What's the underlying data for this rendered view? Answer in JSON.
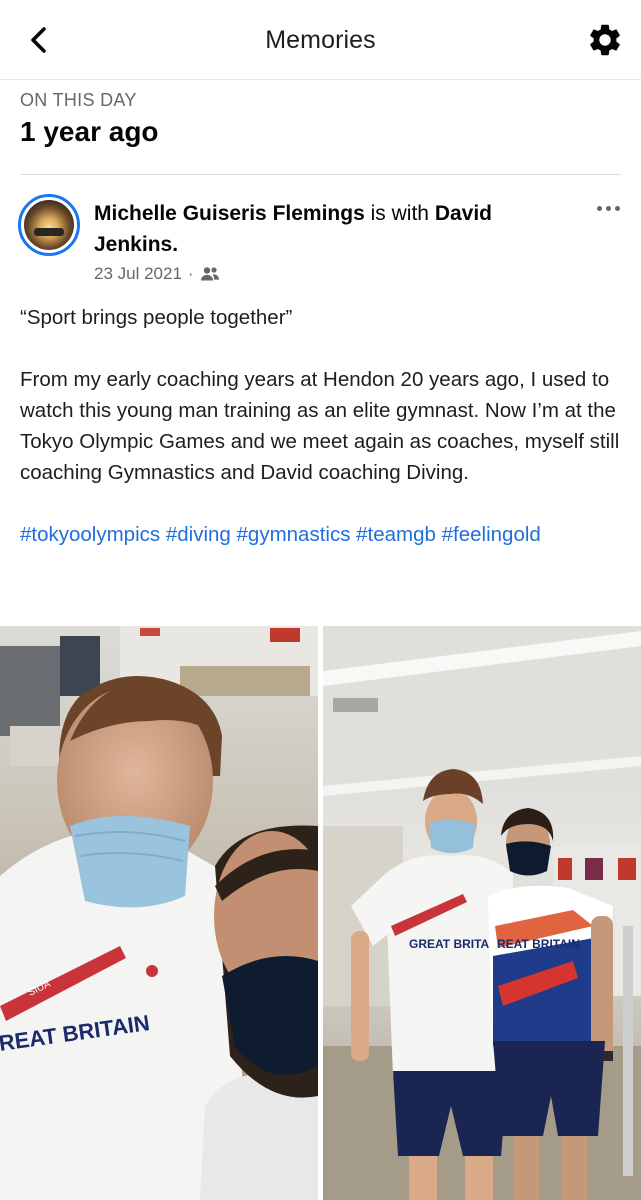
{
  "header": {
    "title": "Memories",
    "back_icon": "chevron-left-icon",
    "settings_icon": "gear-icon"
  },
  "section": {
    "label": "ON THIS DAY",
    "subtitle": "1 year ago"
  },
  "post": {
    "author": "Michelle Guiseris Flemings",
    "with_text": "is with",
    "tagged": "David Jenkins.",
    "date": "23 Jul 2021",
    "separator": "·",
    "audience_icon": "friends-icon",
    "quote": "“Sport brings people together”",
    "body": "From my early coaching years at Hendon 20 years ago, I used to watch this young man training as an elite gymnast. Now I’m at the Tokyo Olympic Games and we meet again as coaches, myself still coaching Gymnastics and David coaching Diving.",
    "hashtags": [
      "#tokyoolympics",
      "#diving",
      "#gymnastics",
      "#teamgb",
      "#feelingold"
    ]
  },
  "photos": {
    "left_shirt_text": "REAT BRITAIN",
    "left_lanyard_text": "SIUA",
    "right_shirt_text_man": "GREAT BRITAI",
    "right_shirt_text_woman": "REAT BRITAIN"
  },
  "colors": {
    "accent": "#1877f2",
    "hashtag": "#216fdb",
    "secondary_text": "#65676b"
  }
}
